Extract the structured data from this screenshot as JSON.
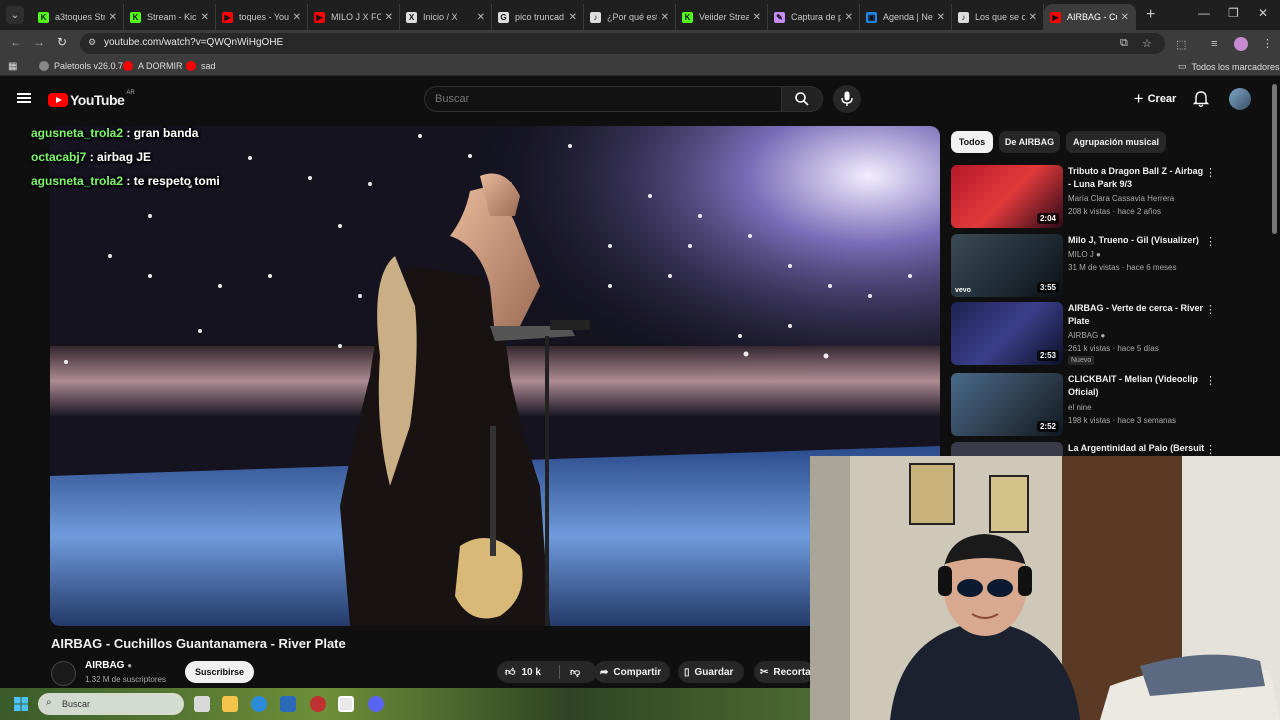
{
  "browser": {
    "tabs": [
      {
        "label": "a3toques Str",
        "favicon_color": "#53fc18",
        "glyph": "K"
      },
      {
        "label": "Stream - Kick",
        "favicon_color": "#53fc18",
        "glyph": "K"
      },
      {
        "label": "toques - You",
        "favicon_color": "#ff0000",
        "glyph": "▶"
      },
      {
        "label": "MILO J X FOT",
        "favicon_color": "#ff0000",
        "glyph": "▶"
      },
      {
        "label": "Inicio / X",
        "favicon_color": "#dddddd",
        "glyph": "X"
      },
      {
        "label": "pico truncad",
        "favicon_color": "#dddddd",
        "glyph": "G"
      },
      {
        "label": "¿Por qué est",
        "favicon_color": "#dddddd",
        "glyph": "♪"
      },
      {
        "label": "Veiider Strea",
        "favicon_color": "#53fc18",
        "glyph": "K"
      },
      {
        "label": "Captura de p",
        "favicon_color": "#c58af9",
        "glyph": "✎"
      },
      {
        "label": "Agenda | Ne",
        "favicon_color": "#1e88e5",
        "glyph": "▣"
      },
      {
        "label": "Los que se o",
        "favicon_color": "#dddddd",
        "glyph": "♪"
      },
      {
        "label": "AIRBAG - Cu",
        "favicon_color": "#ff0000",
        "glyph": "▶",
        "active": true
      }
    ],
    "url": "youtube.com/watch?v=QWQnWiHgOHE",
    "bookmarks": [
      {
        "label": "Paletools v26.0.7",
        "color": "#888888"
      },
      {
        "label": "A DORMIR",
        "color": "#ff0000"
      },
      {
        "label": "sad",
        "color": "#ff0000"
      }
    ],
    "all_bookmarks_label": "Todos los marcadores"
  },
  "youtube": {
    "logo_text": "YouTube",
    "country_code": "AR",
    "search_placeholder": "Buscar",
    "create_label": "Crear"
  },
  "chat": [
    {
      "user": "agusneta_trola2",
      "message": ": gran banda"
    },
    {
      "user": "octacabj7",
      "message": ": airbag JE"
    },
    {
      "user": "agusneta_trola2",
      "message": ": te respeto tomi"
    }
  ],
  "video": {
    "title": "AIRBAG - Cuchillos Guantanamera - River Plate",
    "channel": "AIRBAG",
    "subscribers": "1.32 M de suscriptores",
    "subscribe_label": "Suscribirse",
    "likes": "10 k",
    "share_label": "Compartir",
    "save_label": "Guardar",
    "clip_label": "Recorta"
  },
  "chips": [
    {
      "label": "Todos",
      "active": true
    },
    {
      "label": "De AIRBAG"
    },
    {
      "label": "Agrupación musical"
    }
  ],
  "recommendations": [
    {
      "title": "Tributo a Dragon Ball Z - Airbag - Luna Park 9/3",
      "channel": "María Clara Cassavia Herrera",
      "meta": "208 k vistas · hace 2 años",
      "duration": "2:04",
      "thumb_color": "#b4182a",
      "verified": false
    },
    {
      "title": "Milo J, Trueno - Gil (Visualizer)",
      "channel": "MILO J",
      "meta": "31 M de vistas · hace 6 meses",
      "duration": "3:55",
      "thumb_color": "#1f2a33",
      "verified": true
    },
    {
      "title": "AIRBAG -  Verte de cerca - River Plate",
      "channel": "AIRBAG",
      "meta": "261 k vistas · hace 5 días",
      "duration": "2:53",
      "thumb_color": "#1b2350",
      "verified": true,
      "badge": "Nuevo"
    },
    {
      "title": "CLICKBAIT - Melian (Videoclip Oficial)",
      "channel": "el nine",
      "meta": "198 k vistas · hace 3 semanas",
      "duration": "2:52",
      "thumb_color": "#2b3a4a",
      "verified": false
    },
    {
      "title": "La Argentinidad al Palo (Bersuit",
      "channel": "",
      "meta": "",
      "duration": "",
      "thumb_color": "#3a3a4a",
      "verified": false
    }
  ],
  "taskbar": {
    "search_placeholder": "Buscar"
  }
}
